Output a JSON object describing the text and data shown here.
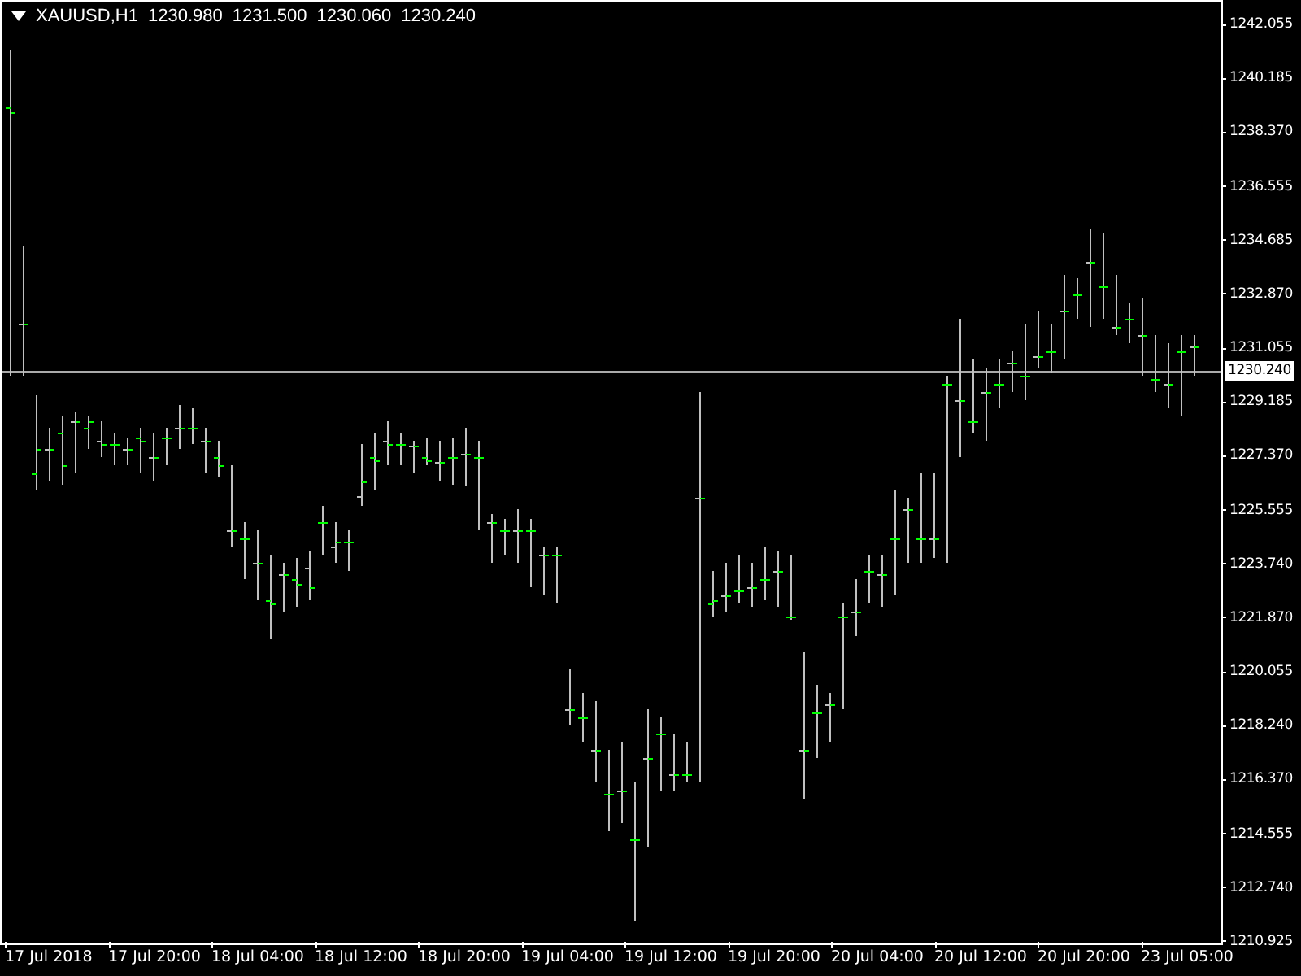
{
  "chart_header": {
    "symbol": "XAUUSD,H1",
    "quotes": [
      "1230.980",
      "1231.500",
      "1230.060",
      "1230.240"
    ]
  },
  "price_axis": {
    "labels": [
      "1242.055",
      "1240.185",
      "1238.370",
      "1236.555",
      "1234.685",
      "1232.870",
      "1231.055",
      "1229.185",
      "1227.370",
      "1225.555",
      "1223.740",
      "1221.870",
      "1220.055",
      "1218.240",
      "1216.370",
      "1214.555",
      "1212.740",
      "1210.925"
    ],
    "current_price": "1230.240"
  },
  "time_axis": {
    "labels": [
      "17 Jul 2018",
      "17 Jul 20:00",
      "18 Jul 04:00",
      "18 Jul 12:00",
      "18 Jul 20:00",
      "19 Jul 04:00",
      "19 Jul 12:00",
      "19 Jul 20:00",
      "20 Jul 04:00",
      "20 Jul 12:00",
      "20 Jul 20:00",
      "23 Jul 05:00"
    ]
  }
}
